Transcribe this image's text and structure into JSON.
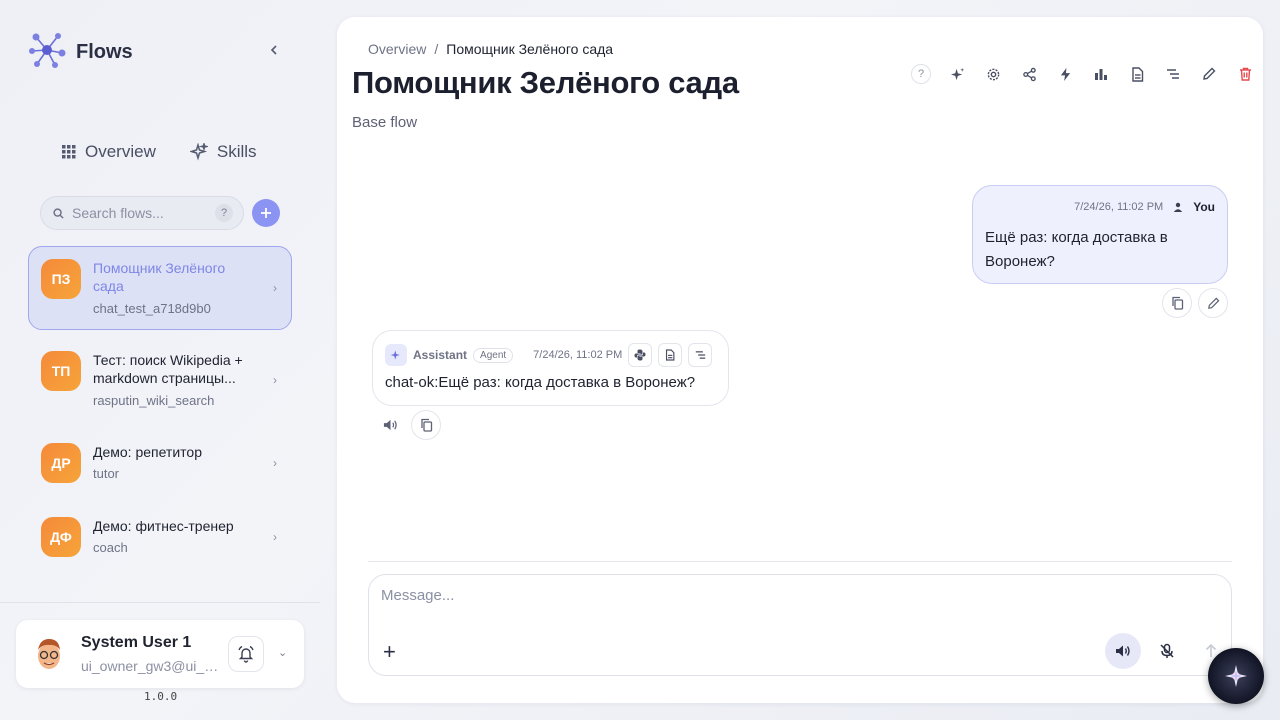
{
  "brand": {
    "name": "Flows"
  },
  "nav": {
    "overview": "Overview",
    "skills": "Skills"
  },
  "search": {
    "placeholder": "Search flows...",
    "help": "?"
  },
  "flows": [
    {
      "initials": "ПЗ",
      "title": "Помощник Зелёного сада",
      "slug": "chat_test_a718d9b0",
      "active": true
    },
    {
      "initials": "ТП",
      "title": "Тест: поиск Wikipedia + markdown страницы...",
      "slug": "rasputin_wiki_search",
      "active": false
    },
    {
      "initials": "ДР",
      "title": "Демо: репетитор",
      "slug": "tutor",
      "active": false
    },
    {
      "initials": "ДФ",
      "title": "Демо: фитнес-тренер",
      "slug": "coach",
      "active": false
    }
  ],
  "user": {
    "name": "System User 1",
    "email": "ui_owner_gw3@ui_e...",
    "version": "1.0.0"
  },
  "breadcrumb": {
    "root": "Overview",
    "sep": "/",
    "current": "Помощник Зелёного сада"
  },
  "page": {
    "title": "Помощник Зелёного сада",
    "subtitle": "Base flow"
  },
  "toolbar": {
    "help": "?"
  },
  "messages": {
    "user": {
      "time": "7/24/26, 11:02 PM",
      "who": "You",
      "text": "Ещё раз: когда доставка в Воронеж?"
    },
    "assistant": {
      "name": "Assistant",
      "badge": "Agent",
      "time": "7/24/26, 11:02 PM",
      "text": "chat-ok:Ещё раз: когда доставка в Воронеж?"
    }
  },
  "composer": {
    "placeholder": "Message...",
    "plus": "+"
  },
  "colors": {
    "accent": "#8b93f3",
    "avatar": "#f58a3a",
    "delete": "#e5484d"
  }
}
